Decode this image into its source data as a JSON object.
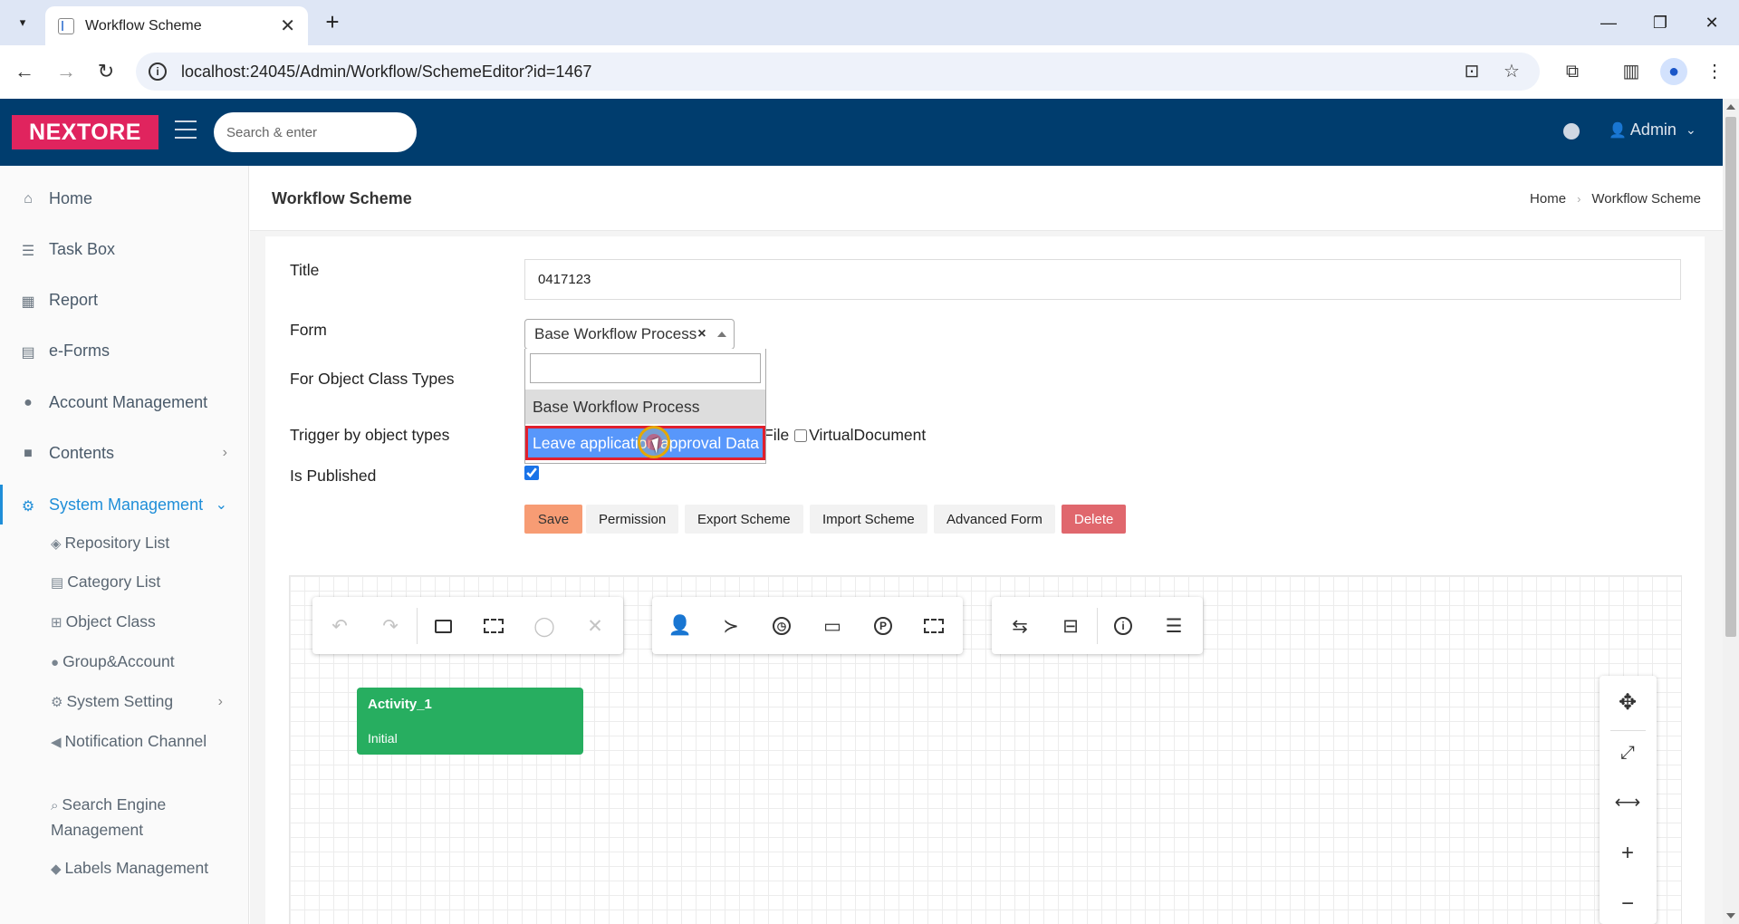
{
  "browser": {
    "tab_title": "Workflow Scheme",
    "tab_close": "✕",
    "new_tab": "+",
    "url": "localhost:24045/Admin/Workflow/SchemeEditor?id=1467",
    "win_minimize": "—",
    "win_restore": "❐",
    "win_close": "✕"
  },
  "header": {
    "logo": "NEXTORE",
    "search_placeholder": "Search & enter",
    "user_name": "Admin"
  },
  "sidebar": {
    "items": [
      {
        "label": "Home",
        "icon": "home-icon"
      },
      {
        "label": "Task Box",
        "icon": "tasks-icon"
      },
      {
        "label": "Report",
        "icon": "table-icon"
      },
      {
        "label": "e-Forms",
        "icon": "form-icon"
      },
      {
        "label": "Account Management",
        "icon": "user-icon"
      },
      {
        "label": "Contents",
        "icon": "folder-icon"
      },
      {
        "label": "System Management",
        "icon": "gears-icon"
      }
    ],
    "sub_items": [
      {
        "label": "Repository List"
      },
      {
        "label": "Category List"
      },
      {
        "label": "Object Class"
      },
      {
        "label": "Group&Account"
      },
      {
        "label": "System Setting"
      },
      {
        "label": "Notification Channel"
      },
      {
        "label": "Search Engine Management"
      },
      {
        "label": "Labels Management"
      }
    ]
  },
  "page": {
    "title": "Workflow Scheme",
    "breadcrumb": [
      "Home",
      "Workflow Scheme"
    ]
  },
  "form": {
    "title_label": "Title",
    "title_value": "0417123",
    "form_label": "Form",
    "form_selected": "Base Workflow Process",
    "object_class_label": "For Object Class Types",
    "trigger_label": "Trigger by object types",
    "trigger_options": [
      "File",
      "VirtualDocument"
    ],
    "published_label": "Is Published",
    "published": true,
    "dropdown_options": [
      "Base Workflow Process",
      "Leave application approval Data"
    ]
  },
  "buttons": {
    "save": "Save",
    "permission": "Permission",
    "export": "Export Scheme",
    "import": "Import Scheme",
    "advanced": "Advanced Form",
    "delete": "Delete"
  },
  "diagram": {
    "activity_name": "Activity_1",
    "activity_type": "Initial",
    "activity_color": "#27ae60"
  },
  "colors": {
    "header_bg": "#003d6e",
    "logo_bg": "#e0245e",
    "accent": "#1f8ed8",
    "highlight": "#5897fb",
    "delete": "#e0676d",
    "save": "#f79c74"
  }
}
